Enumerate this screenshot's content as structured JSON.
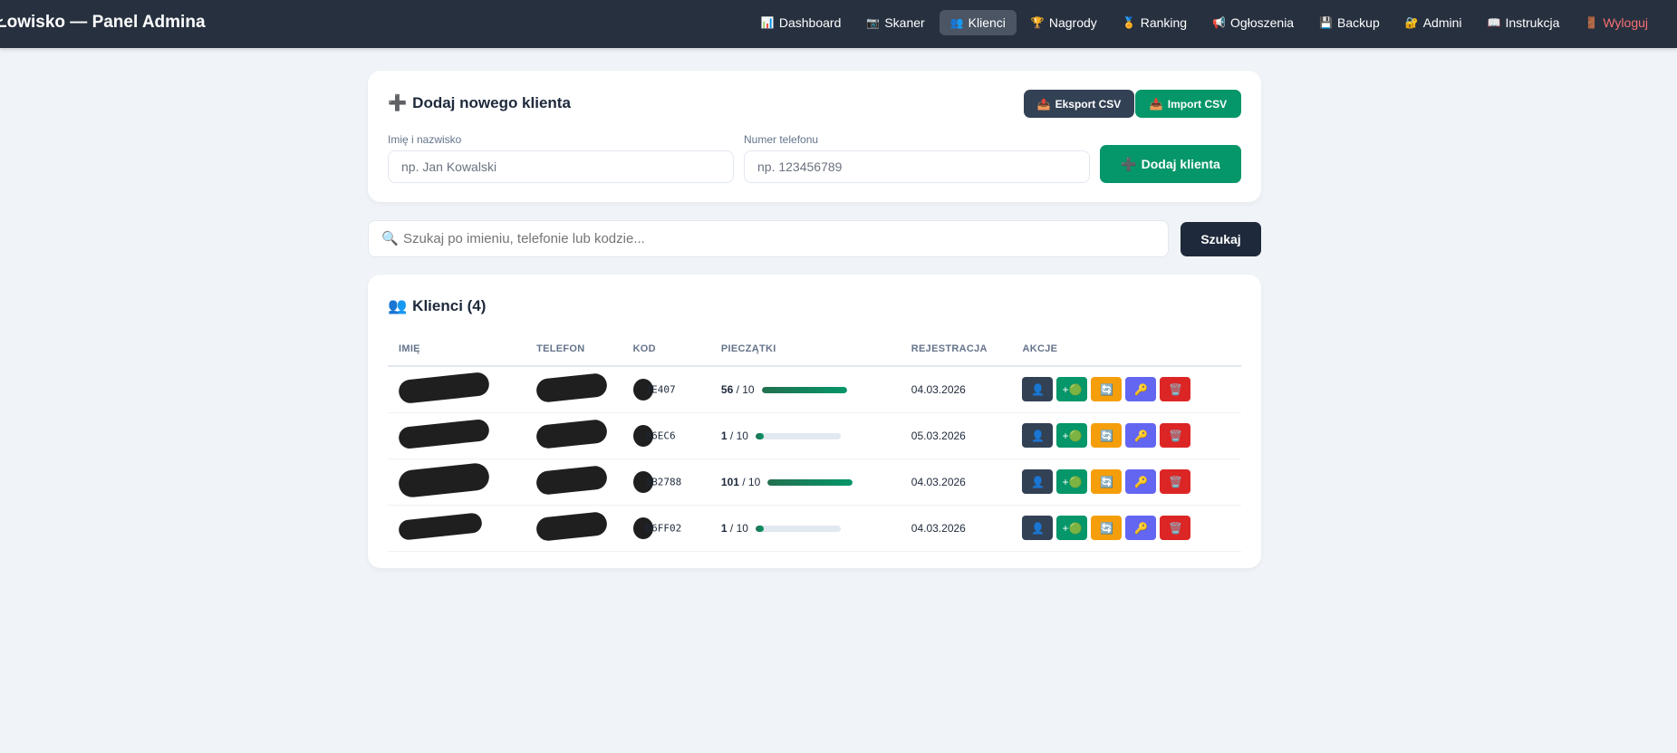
{
  "app": {
    "title": "Łowisko — Panel Admina"
  },
  "nav": [
    {
      "label": "Dashboard",
      "icon": "📊"
    },
    {
      "label": "Skaner",
      "icon": "📷"
    },
    {
      "label": "Klienci",
      "icon": "👥",
      "active": true
    },
    {
      "label": "Nagrody",
      "icon": "🏆"
    },
    {
      "label": "Ranking",
      "icon": "🏅"
    },
    {
      "label": "Ogłoszenia",
      "icon": "📢"
    },
    {
      "label": "Backup",
      "icon": "💾"
    },
    {
      "label": "Admini",
      "icon": "🔐"
    },
    {
      "label": "Instrukcja",
      "icon": "📖"
    },
    {
      "label": "Wyloguj",
      "icon": "🚪"
    }
  ],
  "add": {
    "title": "Dodaj nowego klienta",
    "export": "Eksport CSV",
    "import": "Import CSV",
    "name_label": "Imię i nazwisko",
    "name_placeholder": "np. Jan Kowalski",
    "phone_label": "Numer telefonu",
    "phone_placeholder": "np. 123456789",
    "submit": "Dodaj klienta"
  },
  "search": {
    "placeholder": "Szukaj po imieniu, telefonie lub kodzie...",
    "button": "Szukaj"
  },
  "clients": {
    "title": "Klienci (4)",
    "columns": [
      "IMIĘ",
      "TELEFON",
      "KOD",
      "PIECZĄTKI",
      "REJESTRACJA",
      "AKCJE"
    ],
    "rows": [
      {
        "code": "7E407",
        "stamps": "56",
        "of": "/ 10",
        "progress": 100,
        "date": "04.03.2026"
      },
      {
        "code": "66EC6",
        "stamps": "1",
        "of": "/ 10",
        "progress": 10,
        "date": "05.03.2026"
      },
      {
        "code": "5B2788",
        "stamps": "101",
        "of": "/ 10",
        "progress": 100,
        "date": "04.03.2026"
      },
      {
        "code": "D6FF02",
        "stamps": "1",
        "of": "/ 10",
        "progress": 10,
        "date": "04.03.2026"
      }
    ]
  },
  "colors": {
    "header": "#27303f",
    "green": "#059669",
    "dark": "#334155",
    "orange": "#f59e0b",
    "purple": "#6366f1",
    "red": "#dc2626"
  }
}
